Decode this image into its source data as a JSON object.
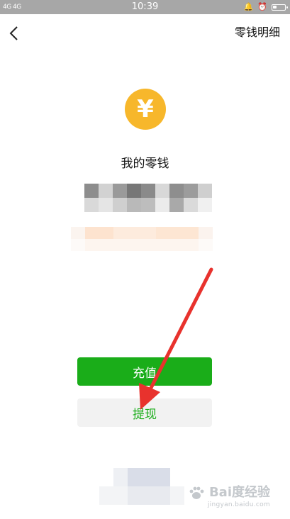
{
  "status_bar": {
    "left_text": "4G 4G",
    "time": "10:39",
    "icons": [
      "alarm-bell-icon",
      "alarm-clock-icon",
      "battery-icon"
    ],
    "battery_level": 0.3
  },
  "header": {
    "back_icon": "chevron-left-icon",
    "right_link": "零钱明细"
  },
  "wallet": {
    "coin_symbol": "¥",
    "title": "我的零钱"
  },
  "buttons": {
    "recharge": "充值",
    "withdraw": "提现"
  },
  "watermark": {
    "brand": "Bai度经验",
    "url": "jingyan.baidu.com"
  },
  "colors": {
    "accent_green": "#1aad19",
    "coin_gold": "#f7b72b",
    "arrow_red": "#e8322d"
  }
}
